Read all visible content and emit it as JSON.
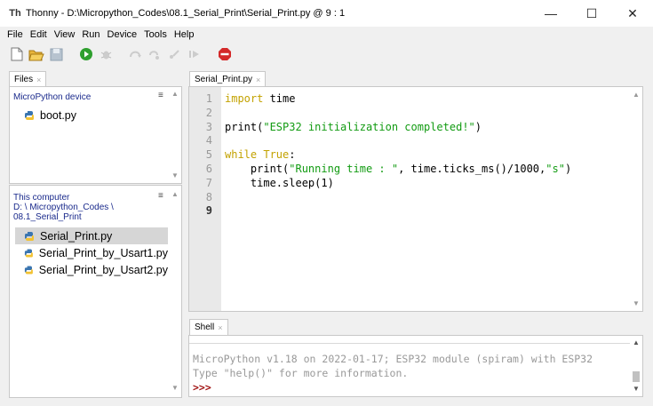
{
  "window": {
    "title": "Thonny  -  D:\\Micropython_Codes\\08.1_Serial_Print\\Serial_Print.py  @  9 : 1",
    "app_icon_text": "Th",
    "minimize": "—",
    "maximize": "☐",
    "close": "✕"
  },
  "menu": [
    "File",
    "Edit",
    "View",
    "Run",
    "Device",
    "Tools",
    "Help"
  ],
  "files_panel": {
    "tab_label": "Files",
    "device_header": "MicroPython device",
    "device_files": [
      "boot.py"
    ],
    "computer_header_1": "This computer",
    "computer_header_2": "D: \\ Micropython_Codes \\",
    "computer_header_3": "08.1_Serial_Print",
    "computer_files": [
      "Serial_Print.py",
      "Serial_Print_by_Usart1.py",
      "Serial_Print_by_Usart2.py"
    ],
    "menu_glyph": "≡"
  },
  "editor": {
    "tab_label": "Serial_Print.py",
    "line_numbers": [
      "1",
      "2",
      "3",
      "4",
      "5",
      "6",
      "7",
      "8",
      "9"
    ],
    "lines": [
      [
        {
          "c": "kw",
          "t": "import"
        },
        {
          "c": "txt",
          "t": " time"
        }
      ],
      [],
      [
        {
          "c": "txt",
          "t": "print("
        },
        {
          "c": "str",
          "t": "\"ESP32 initialization completed!\""
        },
        {
          "c": "txt",
          "t": ")"
        }
      ],
      [],
      [
        {
          "c": "kw",
          "t": "while"
        },
        {
          "c": "txt",
          "t": " "
        },
        {
          "c": "kw",
          "t": "True"
        },
        {
          "c": "txt",
          "t": ":"
        }
      ],
      [
        {
          "c": "txt",
          "t": "    print("
        },
        {
          "c": "str",
          "t": "\"Running time : \""
        },
        {
          "c": "txt",
          "t": ", time.ticks_ms()/1000,"
        },
        {
          "c": "str",
          "t": "\"s\""
        },
        {
          "c": "txt",
          "t": ")"
        }
      ],
      [
        {
          "c": "txt",
          "t": "    time.sleep(1)"
        }
      ],
      [],
      []
    ]
  },
  "shell": {
    "tab_label": "Shell",
    "line1": "MicroPython v1.18 on 2022-01-17; ESP32 module (spiram) with ESP32",
    "line2": "Type \"help()\" for more information.",
    "prompt": ">>>"
  },
  "colors": {
    "keyword": "#c3a200",
    "string": "#129b12",
    "header": "#1a2a8c",
    "prompt": "#a01010"
  }
}
